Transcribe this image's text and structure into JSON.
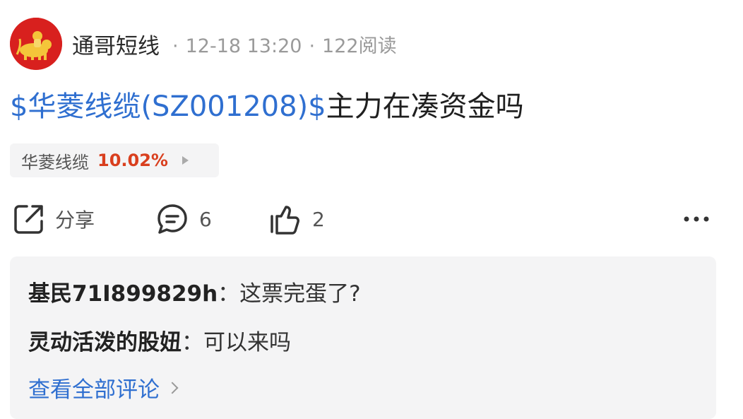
{
  "post": {
    "author": "通哥短线",
    "time": "12-18 13:20",
    "views": "122阅读",
    "title_link": "$华菱线缆(SZ001208)$",
    "title_text": "主力在凑资金吗"
  },
  "stock_chip": {
    "name": "华菱线缆",
    "change": "10.02%"
  },
  "actions": {
    "share_label": "分享",
    "comment_count": "6",
    "like_count": "2"
  },
  "comments": [
    {
      "author": "基民71I899829h",
      "sep": "：",
      "text": "这票完蛋了?"
    },
    {
      "author": "灵动活泼的股妞",
      "sep": "：",
      "text": "可以来吗"
    }
  ],
  "view_all_label": "查看全部评论",
  "colors": {
    "link": "#2f6fd0",
    "up": "#d93f1e",
    "panel": "#f4f4f5"
  }
}
